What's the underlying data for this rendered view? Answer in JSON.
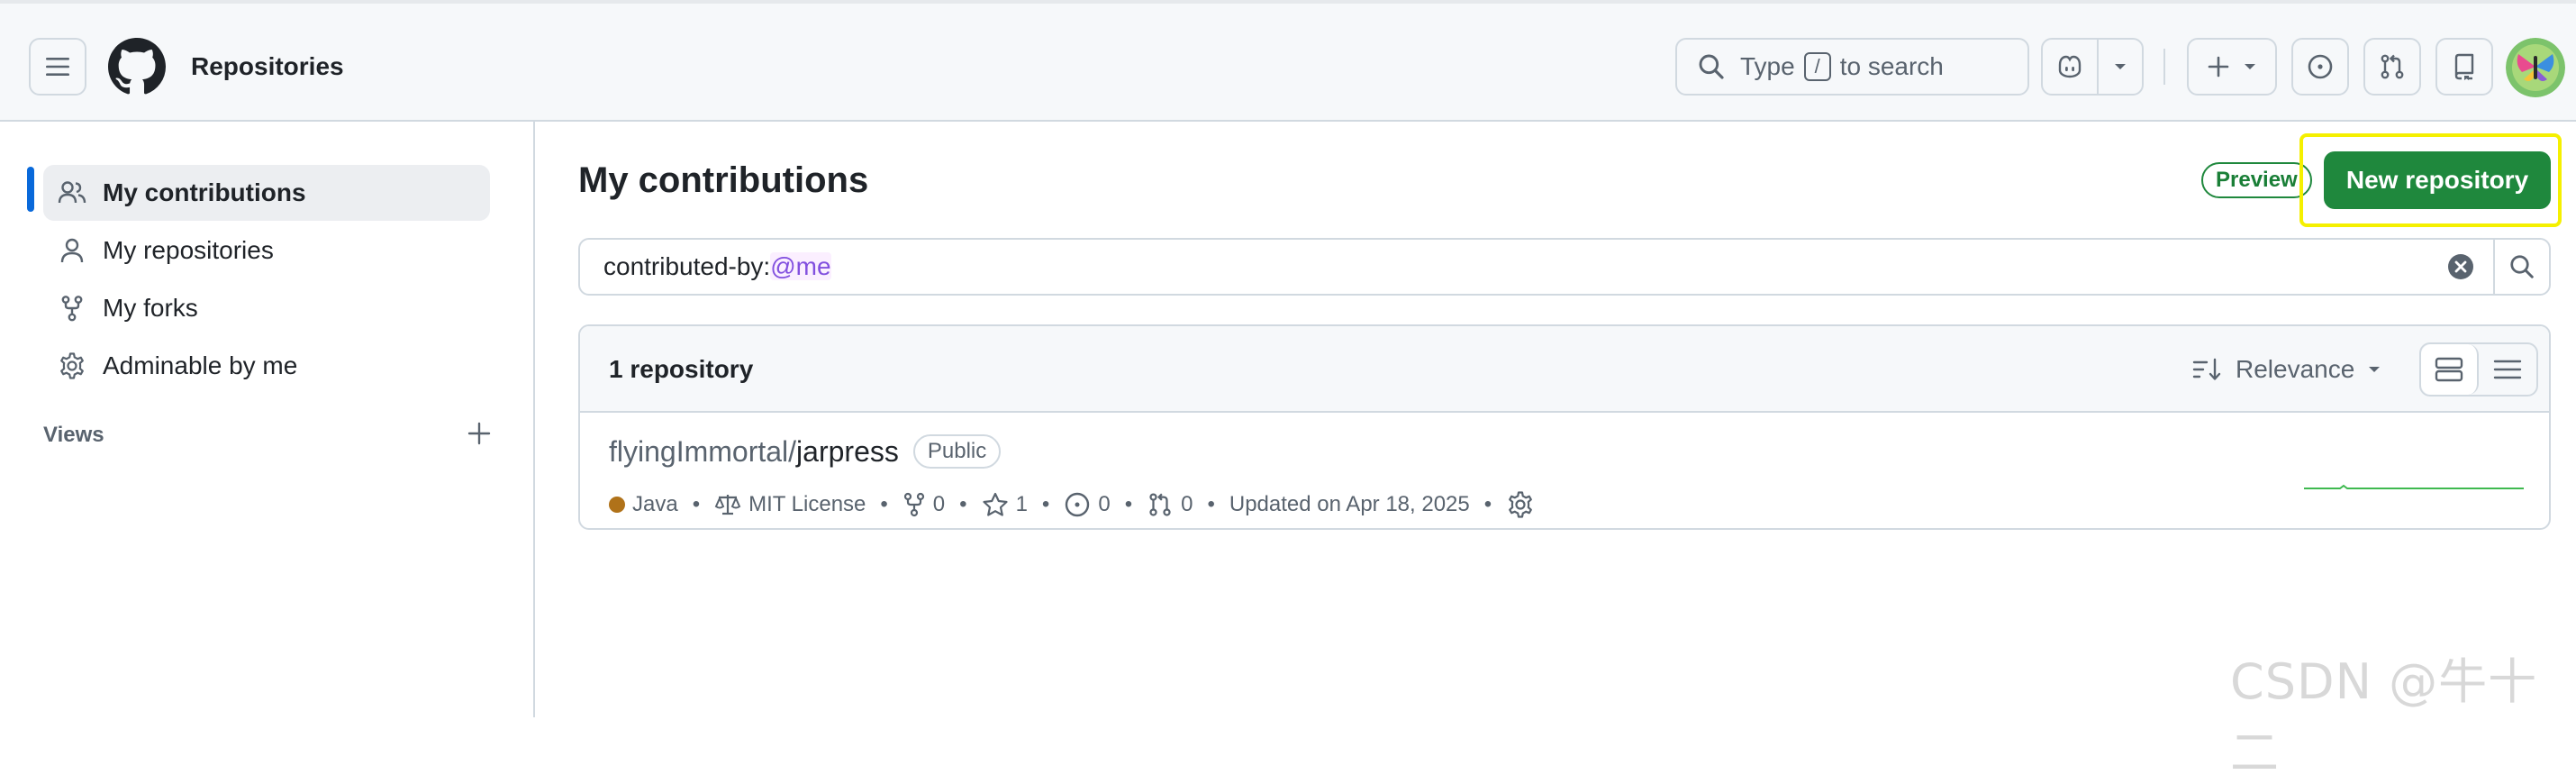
{
  "header": {
    "context_title": "Repositories",
    "search": {
      "prefix": "Type",
      "key": "/",
      "suffix": "to search"
    }
  },
  "sidebar": {
    "items": [
      {
        "label": "My contributions",
        "icon": "people-icon",
        "active": true
      },
      {
        "label": "My repositories",
        "icon": "person-icon",
        "active": false
      },
      {
        "label": "My forks",
        "icon": "fork-icon",
        "active": false
      },
      {
        "label": "Adminable by me",
        "icon": "gear-icon",
        "active": false
      }
    ],
    "views_label": "Views"
  },
  "main": {
    "title": "My contributions",
    "preview_badge": "Preview",
    "new_repo_label": "New repository",
    "filter": {
      "qualifier": "contributed-by:",
      "value": "@me"
    },
    "results": {
      "count_label": "1 repository",
      "sort_label": "Relevance",
      "repos": [
        {
          "owner": "flyingImmortal",
          "slash": "/",
          "name": "jarpress",
          "visibility": "Public",
          "language": "Java",
          "license": "MIT License",
          "forks": "0",
          "stars": "1",
          "issues": "0",
          "pulls": "0",
          "updated": "Updated on Apr 18, 2025"
        }
      ]
    }
  },
  "watermark": "CSDN @牛十二",
  "colors": {
    "accent_blue": "#0969da",
    "primary_green": "#1f883d",
    "java_lang": "#b07219",
    "highlight_yellow": "#f5f000",
    "filter_value_purple": "#8250df"
  }
}
